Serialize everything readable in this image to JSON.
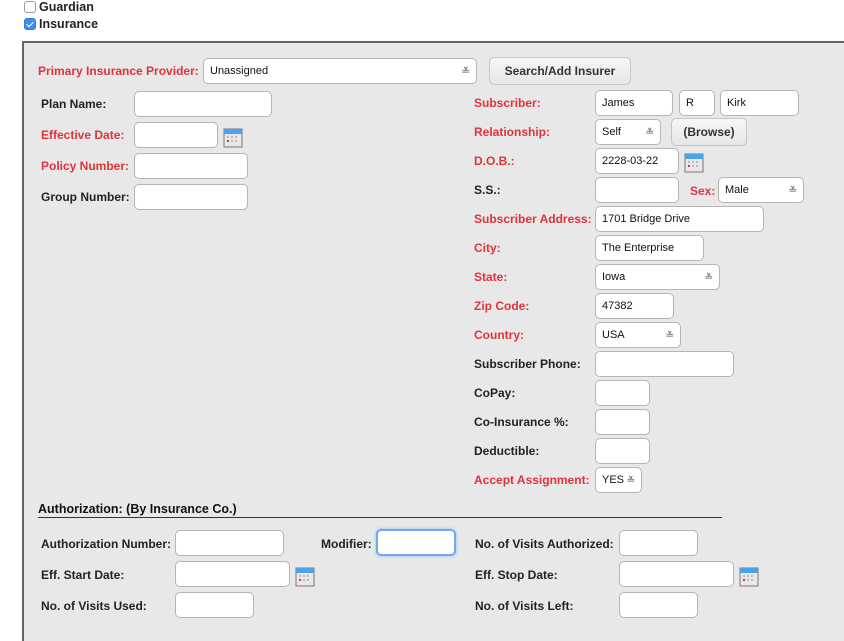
{
  "checkboxes": [
    {
      "label": "Guardian",
      "checked": false
    },
    {
      "label": "Insurance",
      "checked": true
    }
  ],
  "primary_provider": {
    "label": "Primary Insurance Provider:",
    "value": "Unassigned",
    "search_button": "Search/Add Insurer"
  },
  "left_fields": {
    "plan_name": {
      "label": "Plan Name:",
      "value": ""
    },
    "effective_date": {
      "label": "Effective Date:",
      "value": ""
    },
    "policy_number": {
      "label": "Policy Number:",
      "value": ""
    },
    "group_number": {
      "label": "Group Number:",
      "value": ""
    }
  },
  "subscriber": {
    "label": "Subscriber:",
    "first": "James",
    "middle": "R",
    "last": "Kirk",
    "relationship_label": "Relationship:",
    "relationship": "Self",
    "browse_button": "(Browse)",
    "dob_label": "D.O.B.:",
    "dob": "2228-03-22",
    "ss_label": "S.S.:",
    "ss": "",
    "sex_label": "Sex:",
    "sex": "Male",
    "address_label": "Subscriber Address:",
    "address": "1701 Bridge Drive",
    "city_label": "City:",
    "city": "The Enterprise",
    "state_label": "State:",
    "state": "Iowa",
    "zip_label": "Zip Code:",
    "zip": "47382",
    "country_label": "Country:",
    "country": "USA",
    "phone_label": "Subscriber Phone:",
    "phone": "",
    "copay_label": "CoPay:",
    "copay": "",
    "coins_label": "Co-Insurance %:",
    "coins": "",
    "deductible_label": "Deductible:",
    "deductible": "",
    "accept_label": "Accept Assignment:",
    "accept": "YES"
  },
  "authorization": {
    "title": "Authorization: (By Insurance Co.)",
    "auth_number_label": "Authorization Number:",
    "auth_number": "",
    "modifier_label": "Modifier:",
    "modifier": "",
    "visits_authorized_label": "No. of Visits Authorized:",
    "visits_authorized": "",
    "start_date_label": "Eff. Start Date:",
    "start_date": "",
    "stop_date_label": "Eff. Stop Date:",
    "stop_date": "",
    "visits_used_label": "No. of Visits Used:",
    "visits_used": "",
    "visits_left_label": "No. of Visits Left:",
    "visits_left": ""
  },
  "colors": {
    "required_label": "#e0333c",
    "panel_bg": "#e8e8e8",
    "checkbox_checked": "#3b8ff0",
    "focus_ring": "#6ea8f0"
  }
}
